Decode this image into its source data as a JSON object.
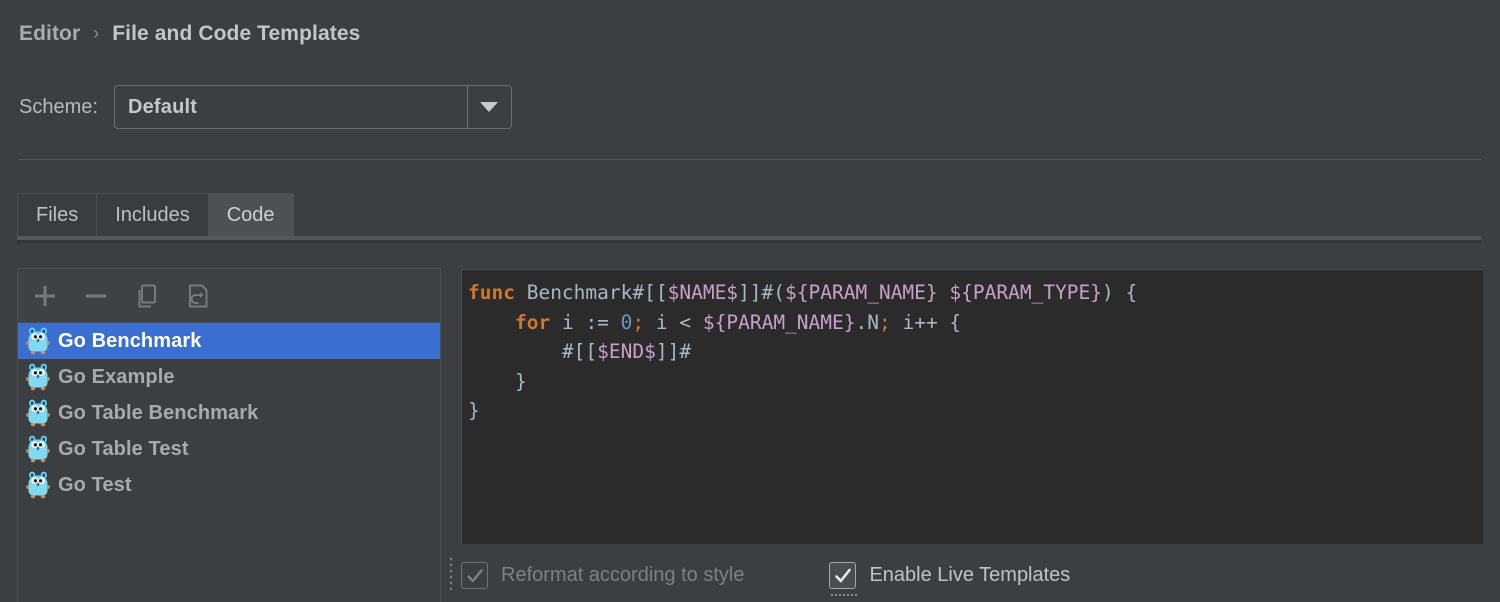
{
  "breadcrumb": {
    "parent": "Editor",
    "separator": "›",
    "current": "File and Code Templates"
  },
  "scheme": {
    "label": "Scheme:",
    "value": "Default",
    "arrow_icon": "chevron-down-icon",
    "options": [
      "Default"
    ]
  },
  "tabs": [
    {
      "label": "Files",
      "selected": false
    },
    {
      "label": "Includes",
      "selected": false
    },
    {
      "label": "Code",
      "selected": true
    }
  ],
  "list_toolbar": [
    {
      "icon": "plus-icon",
      "name": "add-template-button"
    },
    {
      "icon": "minus-icon",
      "name": "remove-template-button"
    },
    {
      "icon": "copy-icon",
      "name": "duplicate-template-button"
    },
    {
      "icon": "reset-icon",
      "name": "reset-template-button"
    }
  ],
  "templates": [
    {
      "label": "Go Benchmark",
      "icon": "go-gopher-icon",
      "selected": true
    },
    {
      "label": "Go Example",
      "icon": "go-gopher-icon",
      "selected": false
    },
    {
      "label": "Go Table Benchmark",
      "icon": "go-gopher-icon",
      "selected": false
    },
    {
      "label": "Go Table Test",
      "icon": "go-gopher-icon",
      "selected": false
    },
    {
      "label": "Go Test",
      "icon": "go-gopher-icon",
      "selected": false
    }
  ],
  "editor": {
    "lines": [
      [
        {
          "t": "func",
          "c": "kw"
        },
        {
          "t": " Benchmark",
          "c": "plain"
        },
        {
          "t": "#[[",
          "c": "plain"
        },
        {
          "t": "$NAME$",
          "c": "var"
        },
        {
          "t": "]]#(",
          "c": "plain"
        },
        {
          "t": "${PARAM_NAME}",
          "c": "var"
        },
        {
          "t": " ",
          "c": "plain"
        },
        {
          "t": "${PARAM_TYPE}",
          "c": "var"
        },
        {
          "t": ") {",
          "c": "plain"
        }
      ],
      [
        {
          "t": "    ",
          "c": "plain"
        },
        {
          "t": "for",
          "c": "kw"
        },
        {
          "t": " i ",
          "c": "plain"
        },
        {
          "t": ":=",
          "c": "plain"
        },
        {
          "t": " ",
          "c": "plain"
        },
        {
          "t": "0",
          "c": "num"
        },
        {
          "t": ";",
          "c": "punc"
        },
        {
          "t": " i < ",
          "c": "plain"
        },
        {
          "t": "${PARAM_NAME}",
          "c": "var"
        },
        {
          "t": ".N",
          "c": "plain"
        },
        {
          "t": ";",
          "c": "punc"
        },
        {
          "t": " i++ {",
          "c": "plain"
        }
      ],
      [
        {
          "t": "        #[[",
          "c": "plain"
        },
        {
          "t": "$END$",
          "c": "var"
        },
        {
          "t": "]]#",
          "c": "plain"
        }
      ],
      [
        {
          "t": "    }",
          "c": "plain"
        }
      ],
      [
        {
          "t": "}",
          "c": "plain"
        }
      ]
    ]
  },
  "options": {
    "reformat": {
      "label": "Reformat according to style",
      "checked": true,
      "enabled": false
    },
    "live_templates": {
      "label": "Enable Live Templates",
      "checked": true,
      "enabled": true,
      "focused": true
    }
  },
  "colors": {
    "page_bg": "#3c3f41",
    "editor_bg": "#2b2b2b",
    "selection_blue": "#3a6ed0",
    "keyword_orange": "#cc7832",
    "variable_pink": "#c9a0c9",
    "number_blue": "#6897bb",
    "text_grey": "#a9b7c6",
    "gopher_blue": "#6ad7f5"
  }
}
